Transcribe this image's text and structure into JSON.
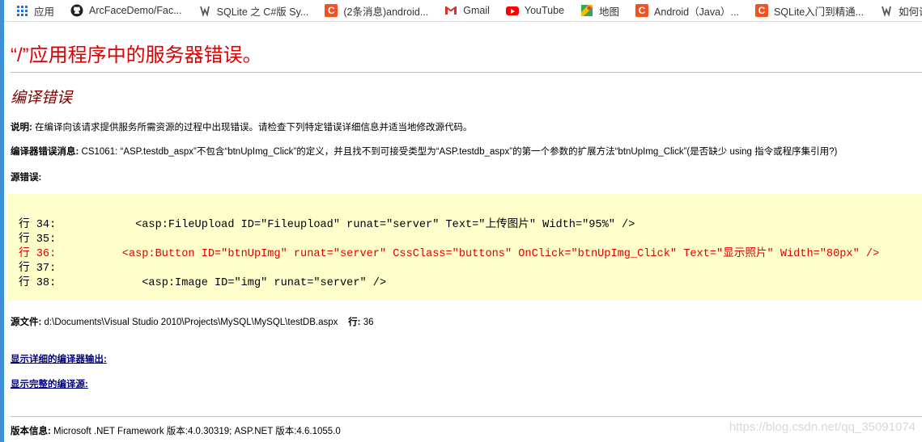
{
  "bookmarks": [
    {
      "icon": "apps-grid-icon",
      "label": "应用"
    },
    {
      "icon": "github-icon",
      "label": "ArcFaceDemo/Fac..."
    },
    {
      "icon": "sqlite-icon",
      "label": "SQLite 之 C#版 Sy..."
    },
    {
      "icon": "csdn-icon",
      "label": "(2条消息)android..."
    },
    {
      "icon": "gmail-icon",
      "label": "Gmail"
    },
    {
      "icon": "youtube-icon",
      "label": "YouTube"
    },
    {
      "icon": "maps-icon",
      "label": "地图"
    },
    {
      "icon": "csdn-icon",
      "label": "Android（Java）..."
    },
    {
      "icon": "csdn-icon",
      "label": "SQLite入门到精通..."
    },
    {
      "icon": "sqlite-icon",
      "label": "如何调试Ja"
    }
  ],
  "error": {
    "title": "“/”应用程序中的服务器错误。",
    "subtitle": "编译错误",
    "desc_label": "说明:",
    "desc_text": " 在编译向该请求提供服务所需资源的过程中出现错误。请检查下列特定错误详细信息并适当地修改源代码。",
    "msg_label": "编译器错误消息:",
    "msg_text": " CS1061: “ASP.testdb_aspx”不包含“btnUpImg_Click”的定义，并且找不到可接受类型为“ASP.testdb_aspx”的第一个参数的扩展方法“btnUpImg_Click”(是否缺少 using 指令或程序集引用?)",
    "src_label": "源错误:",
    "code_lines": [
      {
        "text": "行 34:            <asp:FileUpload ID=\"Fileupload\" runat=\"server\" Text=\"上传图片\" Width=\"95%\" />",
        "highlight": false
      },
      {
        "text": "行 35: ",
        "highlight": false
      },
      {
        "text": "行 36:          <asp:Button ID=\"btnUpImg\" runat=\"server\" CssClass=\"buttons\" OnClick=\"btnUpImg_Click\" Text=\"显示照片\" Width=\"80px\" />",
        "highlight": true
      },
      {
        "text": "行 37: ",
        "highlight": false
      },
      {
        "text": "行 38:             <asp:Image ID=\"img\" runat=\"server\" />",
        "highlight": false
      }
    ],
    "file_label": "源文件:",
    "file_text": " d:\\Documents\\Visual Studio 2010\\Projects\\MySQL\\MySQL\\testDB.aspx",
    "line_label": "行:",
    "line_text": " 36",
    "link_details": "显示详细的编译器输出:",
    "link_source": "显示完整的编译源:",
    "version_label": "版本信息:",
    "version_text": " Microsoft .NET Framework 版本:4.0.30319; ASP.NET 版本:4.6.1055.0"
  },
  "watermark": "https://blog.csdn.net/qq_35091074",
  "colors": {
    "title": "#e00000",
    "subtitle": "#800000",
    "code_bg": "#ffffcc",
    "link": "#000080"
  }
}
